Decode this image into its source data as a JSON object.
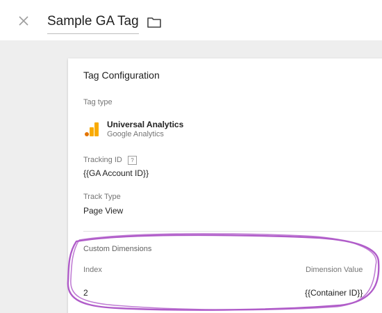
{
  "header": {
    "title": "Sample GA Tag",
    "close_icon": "close-icon",
    "folder_icon": "folder-icon"
  },
  "card": {
    "title": "Tag Configuration",
    "tag_type": {
      "label": "Tag type",
      "name": "Universal Analytics",
      "vendor": "Google Analytics",
      "icon": "google-analytics-logo"
    },
    "tracking_id": {
      "label": "Tracking ID",
      "help_glyph": "?",
      "value": "{{GA Account ID}}"
    },
    "track_type": {
      "label": "Track Type",
      "value": "Page View"
    },
    "custom_dimensions": {
      "label": "Custom Dimensions",
      "columns": [
        "Index",
        "Dimension Value"
      ],
      "rows": [
        {
          "index": "2",
          "value": "{{Container ID}}"
        }
      ]
    }
  },
  "colors": {
    "annotation": "#b05cc9",
    "ga_orange": "#f9ab00",
    "ga_dark_orange": "#e37400"
  }
}
